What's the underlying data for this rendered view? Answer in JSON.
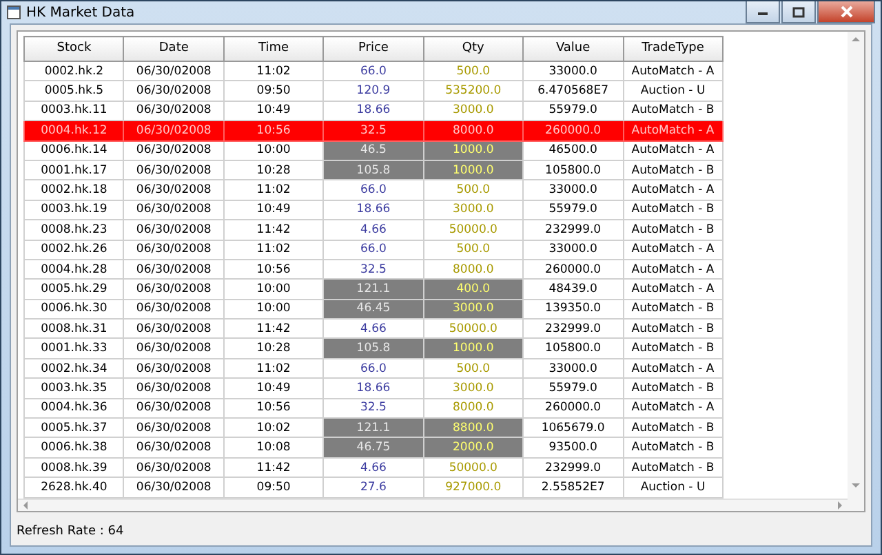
{
  "window": {
    "title": "HK Market Data"
  },
  "table": {
    "columns": [
      "Stock",
      "Date",
      "Time",
      "Price",
      "Qty",
      "Value",
      "TradeType"
    ],
    "rows": [
      {
        "alert": false,
        "changed": false,
        "cells": [
          "0002.hk.2",
          "06/30/02008",
          "11:02",
          "66.0",
          "500.0",
          "33000.0",
          "AutoMatch - A"
        ]
      },
      {
        "alert": false,
        "changed": false,
        "cells": [
          "0005.hk.5",
          "06/30/02008",
          "09:50",
          "120.9",
          "535200.0",
          "6.470568E7",
          "Auction - U"
        ]
      },
      {
        "alert": false,
        "changed": false,
        "cells": [
          "0003.hk.11",
          "06/30/02008",
          "10:49",
          "18.66",
          "3000.0",
          "55979.0",
          "AutoMatch - B"
        ]
      },
      {
        "alert": true,
        "changed": false,
        "cells": [
          "0004.hk.12",
          "06/30/02008",
          "10:56",
          "32.5",
          "8000.0",
          "260000.0",
          "AutoMatch - A"
        ]
      },
      {
        "alert": false,
        "changed": true,
        "cells": [
          "0006.hk.14",
          "06/30/02008",
          "10:00",
          "46.5",
          "1000.0",
          "46500.0",
          "AutoMatch - A"
        ]
      },
      {
        "alert": false,
        "changed": true,
        "cells": [
          "0001.hk.17",
          "06/30/02008",
          "10:28",
          "105.8",
          "1000.0",
          "105800.0",
          "AutoMatch - B"
        ]
      },
      {
        "alert": false,
        "changed": false,
        "cells": [
          "0002.hk.18",
          "06/30/02008",
          "11:02",
          "66.0",
          "500.0",
          "33000.0",
          "AutoMatch - A"
        ]
      },
      {
        "alert": false,
        "changed": false,
        "cells": [
          "0003.hk.19",
          "06/30/02008",
          "10:49",
          "18.66",
          "3000.0",
          "55979.0",
          "AutoMatch - B"
        ]
      },
      {
        "alert": false,
        "changed": false,
        "cells": [
          "0008.hk.23",
          "06/30/02008",
          "11:42",
          "4.66",
          "50000.0",
          "232999.0",
          "AutoMatch - B"
        ]
      },
      {
        "alert": false,
        "changed": false,
        "cells": [
          "0002.hk.26",
          "06/30/02008",
          "11:02",
          "66.0",
          "500.0",
          "33000.0",
          "AutoMatch - A"
        ]
      },
      {
        "alert": false,
        "changed": false,
        "cells": [
          "0004.hk.28",
          "06/30/02008",
          "10:56",
          "32.5",
          "8000.0",
          "260000.0",
          "AutoMatch - A"
        ]
      },
      {
        "alert": false,
        "changed": true,
        "cells": [
          "0005.hk.29",
          "06/30/02008",
          "10:00",
          "121.1",
          "400.0",
          "48439.0",
          "AutoMatch - A"
        ]
      },
      {
        "alert": false,
        "changed": true,
        "cells": [
          "0006.hk.30",
          "06/30/02008",
          "10:00",
          "46.45",
          "3000.0",
          "139350.0",
          "AutoMatch - B"
        ]
      },
      {
        "alert": false,
        "changed": false,
        "cells": [
          "0008.hk.31",
          "06/30/02008",
          "11:42",
          "4.66",
          "50000.0",
          "232999.0",
          "AutoMatch - B"
        ]
      },
      {
        "alert": false,
        "changed": true,
        "cells": [
          "0001.hk.33",
          "06/30/02008",
          "10:28",
          "105.8",
          "1000.0",
          "105800.0",
          "AutoMatch - B"
        ]
      },
      {
        "alert": false,
        "changed": false,
        "cells": [
          "0002.hk.34",
          "06/30/02008",
          "11:02",
          "66.0",
          "500.0",
          "33000.0",
          "AutoMatch - A"
        ]
      },
      {
        "alert": false,
        "changed": false,
        "cells": [
          "0003.hk.35",
          "06/30/02008",
          "10:49",
          "18.66",
          "3000.0",
          "55979.0",
          "AutoMatch - B"
        ]
      },
      {
        "alert": false,
        "changed": false,
        "cells": [
          "0004.hk.36",
          "06/30/02008",
          "10:56",
          "32.5",
          "8000.0",
          "260000.0",
          "AutoMatch - A"
        ]
      },
      {
        "alert": false,
        "changed": true,
        "cells": [
          "0005.hk.37",
          "06/30/02008",
          "10:02",
          "121.1",
          "8800.0",
          "1065679.0",
          "AutoMatch - B"
        ]
      },
      {
        "alert": false,
        "changed": true,
        "cells": [
          "0006.hk.38",
          "06/30/02008",
          "10:08",
          "46.75",
          "2000.0",
          "93500.0",
          "AutoMatch - B"
        ]
      },
      {
        "alert": false,
        "changed": false,
        "cells": [
          "0008.hk.39",
          "06/30/02008",
          "11:42",
          "4.66",
          "50000.0",
          "232999.0",
          "AutoMatch - B"
        ]
      },
      {
        "alert": false,
        "changed": false,
        "cells": [
          "2628.hk.40",
          "06/30/02008",
          "09:50",
          "27.6",
          "927000.0",
          "2.55852E7",
          "Auction - U"
        ]
      }
    ]
  },
  "status_bar": {
    "text": "Refresh Rate : 64"
  }
}
